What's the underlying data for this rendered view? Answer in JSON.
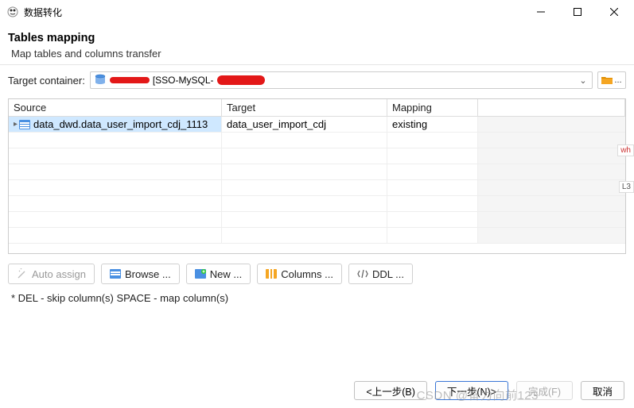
{
  "window": {
    "title": "数据转化"
  },
  "header": {
    "title": "Tables mapping",
    "subtitle": "Map tables and columns transfer"
  },
  "target": {
    "label": "Target container:",
    "mid_text": "[SSO-MySQL-"
  },
  "table": {
    "headers": {
      "source": "Source",
      "target": "Target",
      "mapping": "Mapping"
    },
    "rows": [
      {
        "source": "data_dwd.data_user_import_cdj_1113",
        "target": "data_user_import_cdj",
        "mapping": "existing"
      }
    ]
  },
  "buttons": {
    "auto_assign": "Auto assign",
    "browse": "Browse ...",
    "new": "New ...",
    "columns": "Columns ...",
    "ddl": "DDL ..."
  },
  "note": "* DEL - skip column(s)  SPACE - map column(s)",
  "footer": {
    "back": "<上一步(B)",
    "next": "下一步(N)>",
    "finish": "完成(F)",
    "cancel": "取消"
  },
  "watermark": "CSDN @奋力向前123",
  "edge": {
    "wh": "wh",
    "l3": "L3"
  }
}
